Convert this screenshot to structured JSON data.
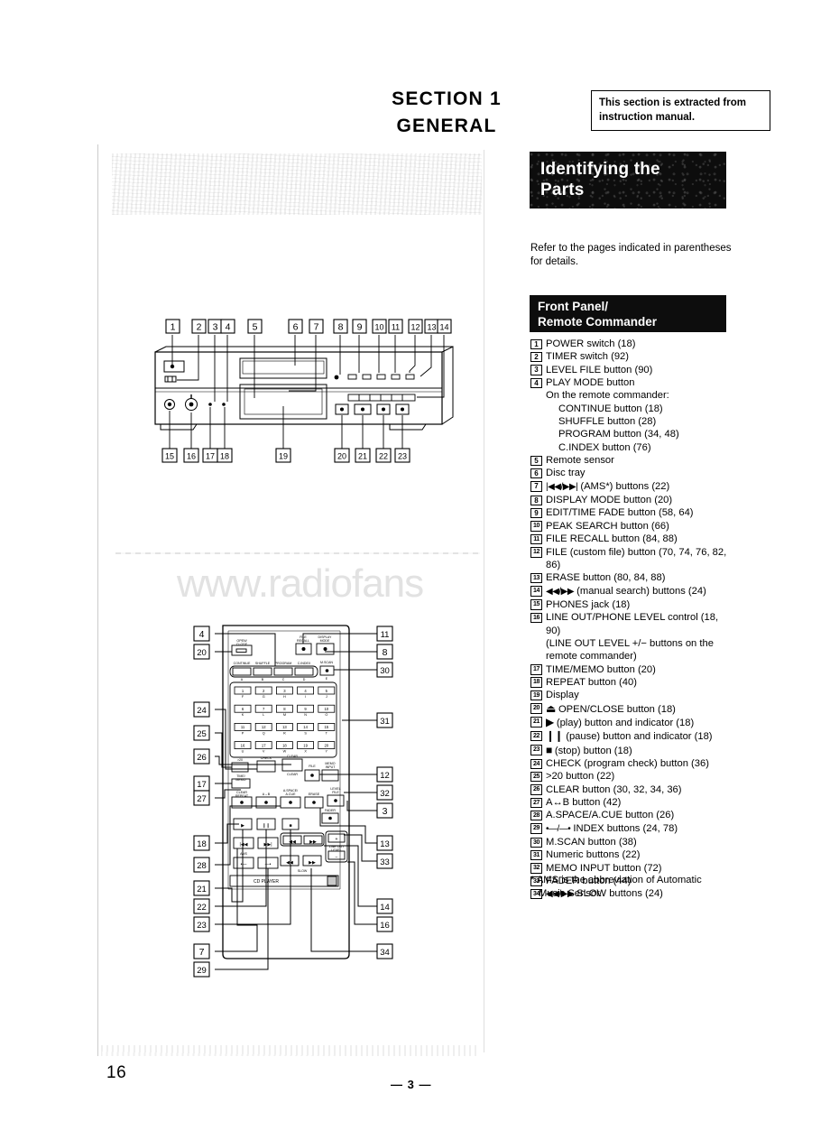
{
  "section": {
    "heading_line1": "SECTION  1",
    "heading_line2": "GENERAL"
  },
  "extract_note": "This section is extracted from instruction manual.",
  "identify_banner": {
    "line1": "Identifying the",
    "line2": "Parts"
  },
  "refer_note": "Refer to the pages indicated in parentheses for details.",
  "front_panel_banner": {
    "line1": "Front Panel/",
    "line2": "Remote Commander"
  },
  "parts_list": [
    {
      "num": "1",
      "text": "POWER switch (18)"
    },
    {
      "num": "2",
      "text": "TIMER switch (92)"
    },
    {
      "num": "3",
      "text": "LEVEL FILE button (90)"
    },
    {
      "num": "4",
      "text": "PLAY MODE button",
      "subs": [
        {
          "indent": 1,
          "text": "On the remote commander:"
        },
        {
          "indent": 2,
          "text": "CONTINUE button (18)"
        },
        {
          "indent": 2,
          "text": "SHUFFLE button (28)"
        },
        {
          "indent": 2,
          "text": "PROGRAM button (34, 48)"
        },
        {
          "indent": 2,
          "text": "C.INDEX button (76)"
        }
      ]
    },
    {
      "num": "5",
      "text": "Remote sensor"
    },
    {
      "num": "6",
      "text": "Disc tray"
    },
    {
      "num": "7",
      "symbol": "|◀◀/▶▶|",
      "text": " (AMS*) buttons (22)"
    },
    {
      "num": "8",
      "text": "DISPLAY MODE button (20)"
    },
    {
      "num": "9",
      "text": "EDIT/TIME FADE button (58, 64)"
    },
    {
      "num": "10",
      "text": "PEAK SEARCH button (66)"
    },
    {
      "num": "11",
      "text": "FILE RECALL button (84, 88)"
    },
    {
      "num": "12",
      "text": "FILE (custom file) button (70, 74, 76, 82,",
      "subs": [
        {
          "indent": 0,
          "text": "86)"
        }
      ]
    },
    {
      "num": "13",
      "text": "ERASE button (80, 84, 88)"
    },
    {
      "num": "14",
      "symbol": "◀◀/▶▶",
      "text": " (manual search) buttons (24)"
    },
    {
      "num": "15",
      "text": "PHONES jack (18)"
    },
    {
      "num": "16",
      "text": "LINE OUT/PHONE LEVEL control (18,",
      "subs": [
        {
          "indent": 0,
          "text": "90)"
        },
        {
          "indent": 0,
          "text": "(LINE OUT LEVEL +/− buttons on the"
        },
        {
          "indent": 0,
          "text": "remote commander)"
        }
      ]
    },
    {
      "num": "17",
      "text": "TIME/MEMO button (20)"
    },
    {
      "num": "18",
      "text": "REPEAT button (40)"
    },
    {
      "num": "19",
      "text": "Display"
    },
    {
      "num": "20",
      "symbol": "⏏",
      "text": " OPEN/CLOSE button (18)"
    },
    {
      "num": "21",
      "symbol": "▶",
      "text": "  (play) button and indicator (18)"
    },
    {
      "num": "22",
      "symbol": "❙❙",
      "text": " (pause) button and indicator (18)"
    },
    {
      "num": "23",
      "symbol": "■",
      "text": " (stop) button (18)"
    },
    {
      "num": "24",
      "text": "CHECK (program check) button (36)"
    },
    {
      "num": "25",
      "text": ">20 button (22)"
    },
    {
      "num": "26",
      "text": "CLEAR button (30, 32, 34, 36)"
    },
    {
      "num": "27",
      "text": "A↔B button (42)"
    },
    {
      "num": "28",
      "text": "A.SPACE/A.CUE button (26)"
    },
    {
      "num": "29",
      "symbol": "•—/—•",
      "text": "  INDEX buttons (24, 78)"
    },
    {
      "num": "30",
      "text": "M.SCAN button (38)"
    },
    {
      "num": "31",
      "text": "Numeric buttons (22)"
    },
    {
      "num": "32",
      "text": "MEMO INPUT button (72)"
    },
    {
      "num": "33",
      "text": "FADER button (44)"
    },
    {
      "num": "34",
      "symbol": "◀◀/▶▶",
      "text": "  SLOW buttons (24)"
    }
  ],
  "ams_note": {
    "line1": "* AMS is the abbreviation of Automatic",
    "line2": "Music Sensor."
  },
  "page_number_left": "16",
  "page_number_center": "— 3 —",
  "watermark": "www.radiofans",
  "front_panel_diagram": {
    "callouts_top": [
      "1",
      "2",
      "3",
      "4",
      "5",
      "6",
      "7",
      "8",
      "9",
      "10",
      "11",
      "12",
      "13",
      "14"
    ],
    "callouts_bottom": [
      "15",
      "16",
      "17",
      "18",
      "19",
      "20",
      "21",
      "22",
      "23"
    ],
    "controls": [
      "POWER switch",
      "TIMER switch",
      "PHONES jack",
      "LINE OUT/PHONE LEVEL",
      "Disc tray",
      "Display",
      "OPEN/CLOSE",
      "play",
      "pause",
      "stop"
    ]
  },
  "remote_diagram": {
    "callouts_left": [
      "4",
      "20",
      "24",
      "25",
      "26",
      "17",
      "27",
      "18",
      "28",
      "21",
      "22",
      "23",
      "7",
      "29"
    ],
    "callouts_right": [
      "11",
      "8",
      "30",
      "31",
      "12",
      "32",
      "3",
      "13",
      "33",
      "14",
      "16",
      "34"
    ],
    "top_buttons": [
      "OPEN/CLOSE",
      "FILE RECALL",
      "DISPLAY MODE",
      "M.SCAN"
    ],
    "play_mode_row": [
      "CONTINUE",
      "SHUFFLE",
      "PROGRAM",
      "C.INDEX"
    ],
    "play_mode_letters": [
      "A",
      "B",
      "C",
      "D",
      "E"
    ],
    "numeric_keys": [
      {
        "n": "1",
        "l": "F"
      },
      {
        "n": "2",
        "l": "G"
      },
      {
        "n": "3",
        "l": "H"
      },
      {
        "n": "4",
        "l": "I"
      },
      {
        "n": "5",
        "l": "J"
      },
      {
        "n": "6",
        "l": "K"
      },
      {
        "n": "7",
        "l": "L"
      },
      {
        "n": "8",
        "l": "M"
      },
      {
        "n": "9",
        "l": "N"
      },
      {
        "n": "10",
        "l": "O"
      },
      {
        "n": "11",
        "l": "P"
      },
      {
        "n": "12",
        "l": "Q"
      },
      {
        "n": "13",
        "l": "R"
      },
      {
        "n": "14",
        "l": "S"
      },
      {
        "n": "15",
        "l": "T"
      },
      {
        "n": "16",
        "l": "U"
      },
      {
        "n": "17",
        "l": "V"
      },
      {
        "n": "18",
        "l": "W"
      },
      {
        "n": "19",
        "l": "X"
      },
      {
        "n": "20",
        "l": "Y"
      }
    ],
    "mid_buttons": [
      ">20",
      "CHECK",
      "CLEAR",
      "FILE",
      "MEMO INPUT",
      "TIME/MEMO",
      "CLEAR REPEAT",
      "A↔B",
      "A.SPACE/A.CUE",
      "ERASE",
      "LEVEL FILE"
    ],
    "transport_labels": [
      "FADER",
      "LINE OUT LEVEL",
      "SLOW",
      "INDEX",
      "CD PLAYER"
    ]
  }
}
